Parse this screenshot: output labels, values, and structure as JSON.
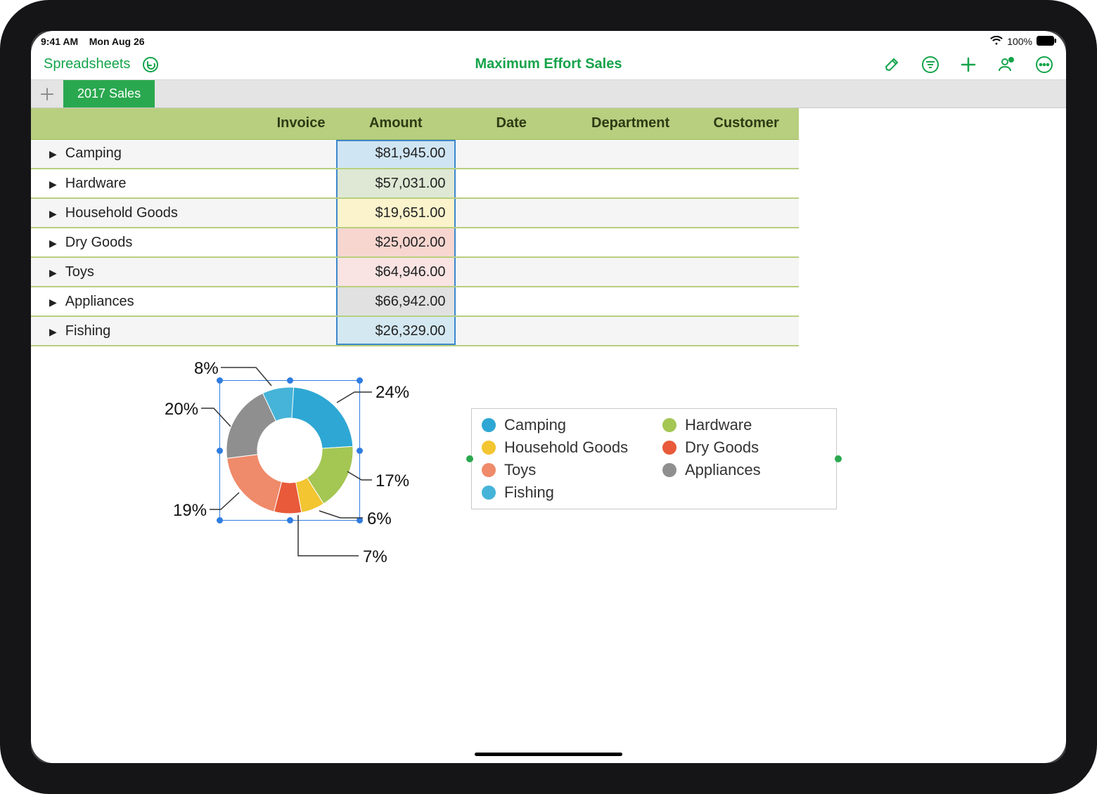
{
  "status": {
    "time": "9:41 AM",
    "date": "Mon Aug 26",
    "battery": "100%"
  },
  "toolbar": {
    "back": "Spreadsheets",
    "title": "Maximum Effort Sales"
  },
  "sheet_tab": "2017 Sales",
  "table": {
    "headers": [
      "",
      "Invoice",
      "Amount",
      "Date",
      "Department",
      "Customer"
    ],
    "rows": [
      {
        "category": "Camping",
        "amount": "$81,945.00",
        "fill": "fill-blue"
      },
      {
        "category": "Hardware",
        "amount": "$57,031.00",
        "fill": "fill-green"
      },
      {
        "category": "Household Goods",
        "amount": "$19,651.00",
        "fill": "fill-yellow"
      },
      {
        "category": "Dry Goods",
        "amount": "$25,002.00",
        "fill": "fill-red"
      },
      {
        "category": "Toys",
        "amount": "$64,946.00",
        "fill": "fill-pink"
      },
      {
        "category": "Appliances",
        "amount": "$66,942.00",
        "fill": "fill-grey"
      },
      {
        "category": "Fishing",
        "amount": "$26,329.00",
        "fill": "fill-blue2"
      }
    ]
  },
  "chart_data": {
    "type": "pie",
    "title": "",
    "series": [
      {
        "name": "Camping",
        "percent": 24,
        "color": "#2ea7d4"
      },
      {
        "name": "Hardware",
        "percent": 17,
        "color": "#a4c653"
      },
      {
        "name": "Household Goods",
        "percent": 6,
        "color": "#f2c531"
      },
      {
        "name": "Dry Goods",
        "percent": 7,
        "color": "#e85a3a"
      },
      {
        "name": "Toys",
        "percent": 19,
        "color": "#ef8a6a"
      },
      {
        "name": "Appliances",
        "percent": 20,
        "color": "#8f8f8f"
      },
      {
        "name": "Fishing",
        "percent": 8,
        "color": "#46b4d8"
      }
    ],
    "labels": {
      "p24": "24%",
      "p17": "17%",
      "p6": "6%",
      "p7": "7%",
      "p19": "19%",
      "p20": "20%",
      "p8": "8%"
    }
  },
  "legend": [
    {
      "name": "Camping",
      "color": "#2ea7d4"
    },
    {
      "name": "Hardware",
      "color": "#a4c653"
    },
    {
      "name": "Household Goods",
      "color": "#f2c531"
    },
    {
      "name": "Dry Goods",
      "color": "#e85a3a"
    },
    {
      "name": "Toys",
      "color": "#ef8a6a"
    },
    {
      "name": "Appliances",
      "color": "#8f8f8f"
    },
    {
      "name": "Fishing",
      "color": "#46b4d8"
    }
  ]
}
